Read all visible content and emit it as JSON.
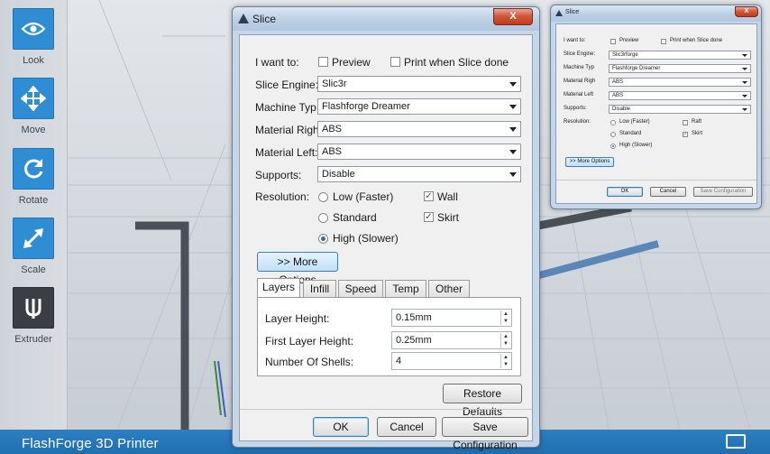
{
  "toolbar": {
    "items": [
      {
        "label": "Look",
        "icon": "eye-icon"
      },
      {
        "label": "Move",
        "icon": "move-arrows-icon"
      },
      {
        "label": "Rotate",
        "icon": "rotate-icon"
      },
      {
        "label": "Scale",
        "icon": "scale-arrow-icon"
      },
      {
        "label": "Extruder",
        "icon": "extruder-icon"
      }
    ]
  },
  "appbar": {
    "title": "FlashForge 3D Printer",
    "icon": "window-icon"
  },
  "slice_dialog": {
    "title": "Slice",
    "close_label": "X",
    "want_label": "I want to:",
    "preview_label": "Preview",
    "preview_checked": false,
    "print_done_label": "Print when Slice done",
    "print_done_checked": false,
    "engine_label": "Slice Engine:",
    "engine_value": "Slic3r",
    "machine_label": "Machine Typ",
    "machine_value": "Flashforge Dreamer",
    "mat_right_label": "Material Righ",
    "mat_right_value": "ABS",
    "mat_left_label": "Material Left:",
    "mat_left_value": "ABS",
    "supports_label": "Supports:",
    "supports_value": "Disable",
    "resolution_label": "Resolution:",
    "res_low": "Low (Faster)",
    "res_standard": "Standard",
    "res_high": "High (Slower)",
    "res_selected": "high",
    "wall_label": "Wall",
    "wall_checked": true,
    "skirt_label": "Skirt",
    "skirt_checked": true,
    "more_options_label": ">> More Options",
    "tabs": [
      "Layers",
      "Infill",
      "Speed",
      "Temp",
      "Other"
    ],
    "active_tab": "Layers",
    "layer_height_label": "Layer Height:",
    "layer_height_value": "0.15mm",
    "first_layer_label": "First Layer Height:",
    "first_layer_value": "0.25mm",
    "shells_label": "Number Of Shells:",
    "shells_value": "4",
    "restore_label": "Restore Defaults",
    "ok_label": "OK",
    "cancel_label": "Cancel",
    "save_label": "Save Configuration"
  },
  "small_dialog": {
    "title": "Slice",
    "close_label": "X",
    "want_label": "I want to:",
    "preview_label": "Preview",
    "print_done_label": "Print when Slice done",
    "engine_label": "Slice Engine:",
    "engine_value": "Slic3rforge",
    "machine_label": "Machine Typ",
    "machine_value": "Flashforge Dreamer",
    "mat_right_label": "Material Righ",
    "mat_right_value": "ABS",
    "mat_left_label": "Material Left",
    "mat_left_value": "ABS",
    "supports_label": "Supports:",
    "supports_value": "Disable",
    "resolution_label": "Resolution:",
    "res_low": "Low (Faster)",
    "res_standard": "Standard",
    "res_high": "High (Slower)",
    "raft_label": "Raft",
    "skirt_label": "Skirt",
    "more_options_label": ">> More Options",
    "ok_label": "OK",
    "cancel_label": "Cancel",
    "save_label": "Save Configuration"
  },
  "colors": {
    "accent": "#2f8dd3",
    "appbar": "#2373b3",
    "dialog_frame": "#c5d6e8",
    "close_button": "#c94a2e"
  }
}
